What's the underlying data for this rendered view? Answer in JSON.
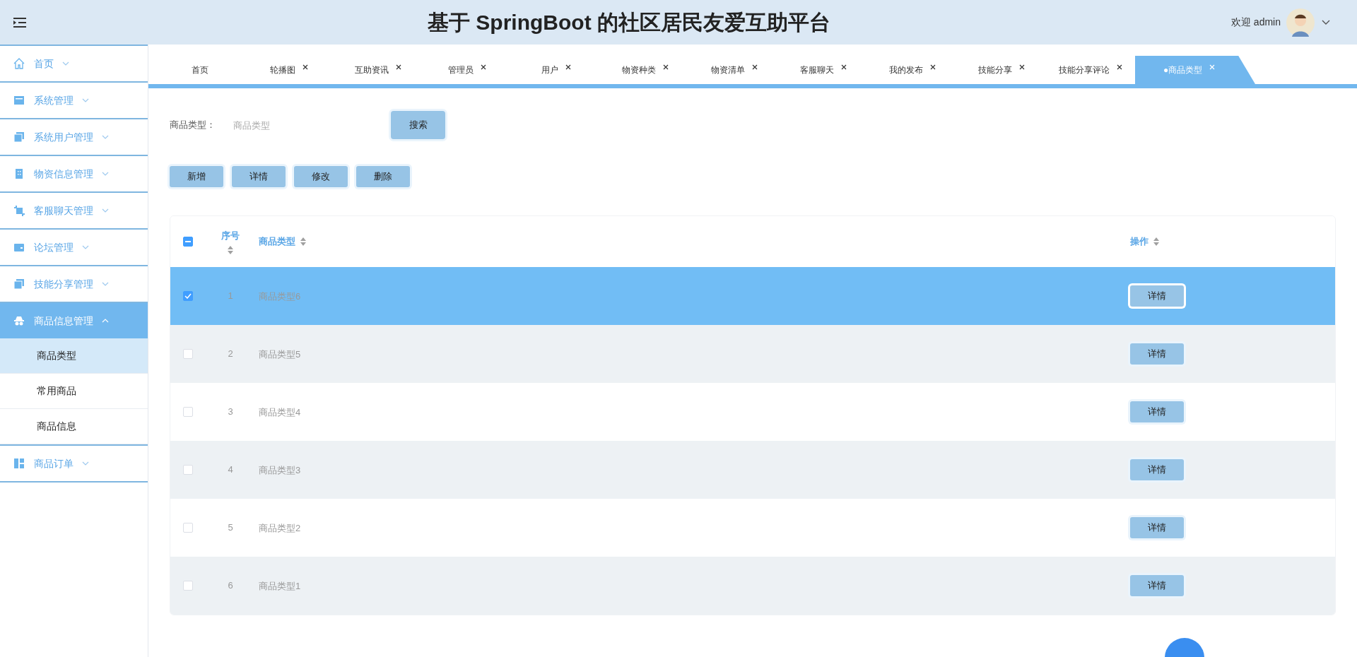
{
  "header": {
    "title": "基于 SpringBoot 的社区居民友爱互助平台",
    "welcome": "欢迎 admin"
  },
  "sidebar": {
    "items": [
      {
        "label": "首页",
        "expanded": false,
        "selected": false
      },
      {
        "label": "系统管理",
        "expanded": false,
        "selected": false
      },
      {
        "label": "系统用户管理",
        "expanded": false,
        "selected": false
      },
      {
        "label": "物资信息管理",
        "expanded": false,
        "selected": false
      },
      {
        "label": "客服聊天管理",
        "expanded": false,
        "selected": false
      },
      {
        "label": "论坛管理",
        "expanded": false,
        "selected": false
      },
      {
        "label": "技能分享管理",
        "expanded": false,
        "selected": false
      },
      {
        "label": "商品信息管理",
        "expanded": true,
        "selected": true,
        "children": [
          {
            "label": "商品类型",
            "selected": true
          },
          {
            "label": "常用商品",
            "selected": false
          },
          {
            "label": "商品信息",
            "selected": false
          }
        ]
      },
      {
        "label": "商品订单",
        "expanded": false,
        "selected": false
      }
    ]
  },
  "tabs": [
    {
      "label": "首页",
      "closable": false,
      "selected": false
    },
    {
      "label": "轮播图",
      "closable": true,
      "selected": false
    },
    {
      "label": "互助资讯",
      "closable": true,
      "selected": false
    },
    {
      "label": "管理员",
      "closable": true,
      "selected": false
    },
    {
      "label": "用户",
      "closable": true,
      "selected": false
    },
    {
      "label": "物资种类",
      "closable": true,
      "selected": false
    },
    {
      "label": "物资清单",
      "closable": true,
      "selected": false
    },
    {
      "label": "客服聊天",
      "closable": true,
      "selected": false
    },
    {
      "label": "我的发布",
      "closable": true,
      "selected": false
    },
    {
      "label": "技能分享",
      "closable": true,
      "selected": false
    },
    {
      "label": "技能分享评论",
      "closable": true,
      "selected": false
    },
    {
      "label": "●商品类型",
      "closable": true,
      "selected": true
    }
  ],
  "search": {
    "label": "商品类型：",
    "placeholder": "商品类型",
    "button": "搜索"
  },
  "actions": [
    "新增",
    "详情",
    "修改",
    "删除"
  ],
  "table": {
    "select_all": {
      "checked": true,
      "indeterminate": true
    },
    "columns": [
      "序号",
      "商品类型",
      "操作"
    ],
    "rows": [
      {
        "index": "1",
        "name": "商品类型6",
        "action": "详情",
        "selected": true
      },
      {
        "index": "2",
        "name": "商品类型5",
        "action": "详情",
        "selected": false
      },
      {
        "index": "3",
        "name": "商品类型4",
        "action": "详情",
        "selected": false
      },
      {
        "index": "4",
        "name": "商品类型3",
        "action": "详情",
        "selected": false
      },
      {
        "index": "5",
        "name": "商品类型2",
        "action": "详情",
        "selected": false
      },
      {
        "index": "6",
        "name": "商品类型1",
        "action": "详情",
        "selected": false
      }
    ]
  }
}
